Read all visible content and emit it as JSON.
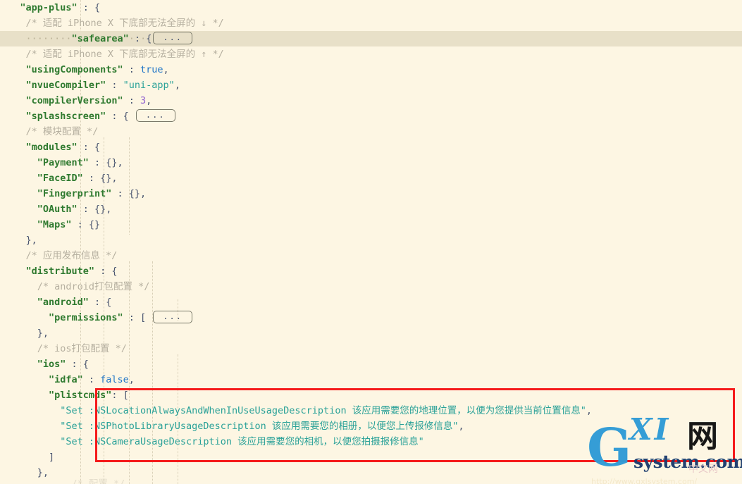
{
  "editor": {
    "language": "json",
    "theme": "solarized-light",
    "background_color": "#fdf6e3",
    "highlight_line_color": "#e8e0c8",
    "annotation_box_color": "#f51b1b"
  },
  "code": {
    "lines": [
      {
        "indent": 3,
        "highlighted": false,
        "tokens": [
          {
            "type": "key",
            "text": "\"app-plus\""
          },
          {
            "type": "punct",
            "text": " : {"
          }
        ]
      },
      {
        "indent": 4,
        "highlighted": false,
        "tokens": [
          {
            "type": "cmt",
            "text": "/* 适配 iPhone X 下底部无法全屏的 ↓ */"
          }
        ]
      },
      {
        "indent": 4,
        "highlighted": true,
        "tokens": [
          {
            "type": "ws",
            "text": "········"
          },
          {
            "type": "key",
            "text": "\"safearea\""
          },
          {
            "type": "ws",
            "text": "·"
          },
          {
            "type": "punct",
            "text": ":"
          },
          {
            "type": "ws",
            "text": "·"
          },
          {
            "type": "punct",
            "text": "{"
          },
          {
            "type": "fold",
            "text": "..."
          }
        ]
      },
      {
        "indent": 4,
        "highlighted": false,
        "tokens": [
          {
            "type": "cmt",
            "text": "/* 适配 iPhone X 下底部无法全屏的 ↑ */"
          }
        ]
      },
      {
        "indent": 4,
        "highlighted": false,
        "tokens": [
          {
            "type": "key",
            "text": "\"usingComponents\""
          },
          {
            "type": "punct",
            "text": " : "
          },
          {
            "type": "bool",
            "text": "true"
          },
          {
            "type": "punct",
            "text": ","
          }
        ]
      },
      {
        "indent": 4,
        "highlighted": false,
        "tokens": [
          {
            "type": "key",
            "text": "\"nvueCompiler\""
          },
          {
            "type": "punct",
            "text": " : "
          },
          {
            "type": "str",
            "text": "\"uni-app\""
          },
          {
            "type": "punct",
            "text": ","
          }
        ]
      },
      {
        "indent": 4,
        "highlighted": false,
        "tokens": [
          {
            "type": "key",
            "text": "\"compilerVersion\""
          },
          {
            "type": "punct",
            "text": " : "
          },
          {
            "type": "num",
            "text": "3"
          },
          {
            "type": "punct",
            "text": ","
          }
        ]
      },
      {
        "indent": 4,
        "highlighted": false,
        "tokens": [
          {
            "type": "key",
            "text": "\"splashscreen\""
          },
          {
            "type": "punct",
            "text": " : { "
          },
          {
            "type": "fold",
            "text": "..."
          }
        ]
      },
      {
        "indent": 4,
        "highlighted": false,
        "tokens": [
          {
            "type": "cmt",
            "text": "/* 模块配置 */"
          }
        ]
      },
      {
        "indent": 4,
        "highlighted": false,
        "tokens": [
          {
            "type": "key",
            "text": "\"modules\""
          },
          {
            "type": "punct",
            "text": " : {"
          }
        ]
      },
      {
        "indent": 6,
        "highlighted": false,
        "tokens": [
          {
            "type": "key",
            "text": "\"Payment\""
          },
          {
            "type": "punct",
            "text": " : {},"
          }
        ]
      },
      {
        "indent": 6,
        "highlighted": false,
        "tokens": [
          {
            "type": "key",
            "text": "\"FaceID\""
          },
          {
            "type": "punct",
            "text": " : {},"
          }
        ]
      },
      {
        "indent": 6,
        "highlighted": false,
        "tokens": [
          {
            "type": "key",
            "text": "\"Fingerprint\""
          },
          {
            "type": "punct",
            "text": " : {},"
          }
        ]
      },
      {
        "indent": 6,
        "highlighted": false,
        "tokens": [
          {
            "type": "key",
            "text": "\"OAuth\""
          },
          {
            "type": "punct",
            "text": " : {},"
          }
        ]
      },
      {
        "indent": 6,
        "highlighted": false,
        "tokens": [
          {
            "type": "key",
            "text": "\"Maps\""
          },
          {
            "type": "punct",
            "text": " : {}"
          }
        ]
      },
      {
        "indent": 4,
        "highlighted": false,
        "tokens": [
          {
            "type": "punct",
            "text": "},"
          }
        ]
      },
      {
        "indent": 4,
        "highlighted": false,
        "tokens": [
          {
            "type": "cmt",
            "text": "/* 应用发布信息 */"
          }
        ]
      },
      {
        "indent": 4,
        "highlighted": false,
        "tokens": [
          {
            "type": "key",
            "text": "\"distribute\""
          },
          {
            "type": "punct",
            "text": " : {"
          }
        ]
      },
      {
        "indent": 6,
        "highlighted": false,
        "tokens": [
          {
            "type": "cmt",
            "text": "/* android打包配置 */"
          }
        ]
      },
      {
        "indent": 6,
        "highlighted": false,
        "tokens": [
          {
            "type": "key",
            "text": "\"android\""
          },
          {
            "type": "punct",
            "text": " : {"
          }
        ]
      },
      {
        "indent": 8,
        "highlighted": false,
        "tokens": [
          {
            "type": "key",
            "text": "\"permissions\""
          },
          {
            "type": "punct",
            "text": " : [ "
          },
          {
            "type": "fold",
            "text": "..."
          }
        ]
      },
      {
        "indent": 6,
        "highlighted": false,
        "tokens": [
          {
            "type": "punct",
            "text": "},"
          }
        ]
      },
      {
        "indent": 6,
        "highlighted": false,
        "tokens": [
          {
            "type": "cmt",
            "text": "/* ios打包配置 */"
          }
        ]
      },
      {
        "indent": 6,
        "highlighted": false,
        "tokens": [
          {
            "type": "key",
            "text": "\"ios\""
          },
          {
            "type": "punct",
            "text": " : {"
          }
        ]
      },
      {
        "indent": 8,
        "highlighted": false,
        "tokens": [
          {
            "type": "key",
            "text": "\"idfa\""
          },
          {
            "type": "punct",
            "text": " : "
          },
          {
            "type": "bool",
            "text": "false"
          },
          {
            "type": "punct",
            "text": ","
          }
        ]
      },
      {
        "indent": 8,
        "highlighted": false,
        "tokens": [
          {
            "type": "key",
            "text": "\"plistcmds\""
          },
          {
            "type": "punct",
            "text": ": ["
          }
        ]
      },
      {
        "indent": 10,
        "highlighted": false,
        "tokens": [
          {
            "type": "str",
            "text": "\"Set :NSLocationAlwaysAndWhenInUseUsageDescription 该应用需要您的地理位置，以便为您提供当前位置信息\""
          },
          {
            "type": "punct",
            "text": ","
          }
        ]
      },
      {
        "indent": 10,
        "highlighted": false,
        "tokens": [
          {
            "type": "str",
            "text": "\"Set :NSPhotoLibraryUsageDescription 该应用需要您的相册，以便您上传报修信息\""
          },
          {
            "type": "punct",
            "text": ","
          }
        ]
      },
      {
        "indent": 10,
        "highlighted": false,
        "tokens": [
          {
            "type": "str",
            "text": "\"Set :NSCameraUsageDescription 该应用需要您的相机，以便您拍摄报修信息\""
          }
        ]
      },
      {
        "indent": 8,
        "highlighted": false,
        "tokens": [
          {
            "type": "punct",
            "text": "]"
          }
        ]
      },
      {
        "indent": 6,
        "highlighted": false,
        "tokens": [
          {
            "type": "punct",
            "text": "},"
          }
        ]
      }
    ],
    "clipped_last_line": {
      "indent": 6,
      "text": "/* 配置 */"
    }
  },
  "annotation": {
    "type": "red-rectangle",
    "covers": "plistcmds array block"
  },
  "watermark": {
    "logo_letter": "G",
    "logo_xi": "XI",
    "logo_cjk": "网",
    "logo_sub": "system.com",
    "logo_sub2": "中文网",
    "url": "http://www.gxlsystem.com/"
  }
}
